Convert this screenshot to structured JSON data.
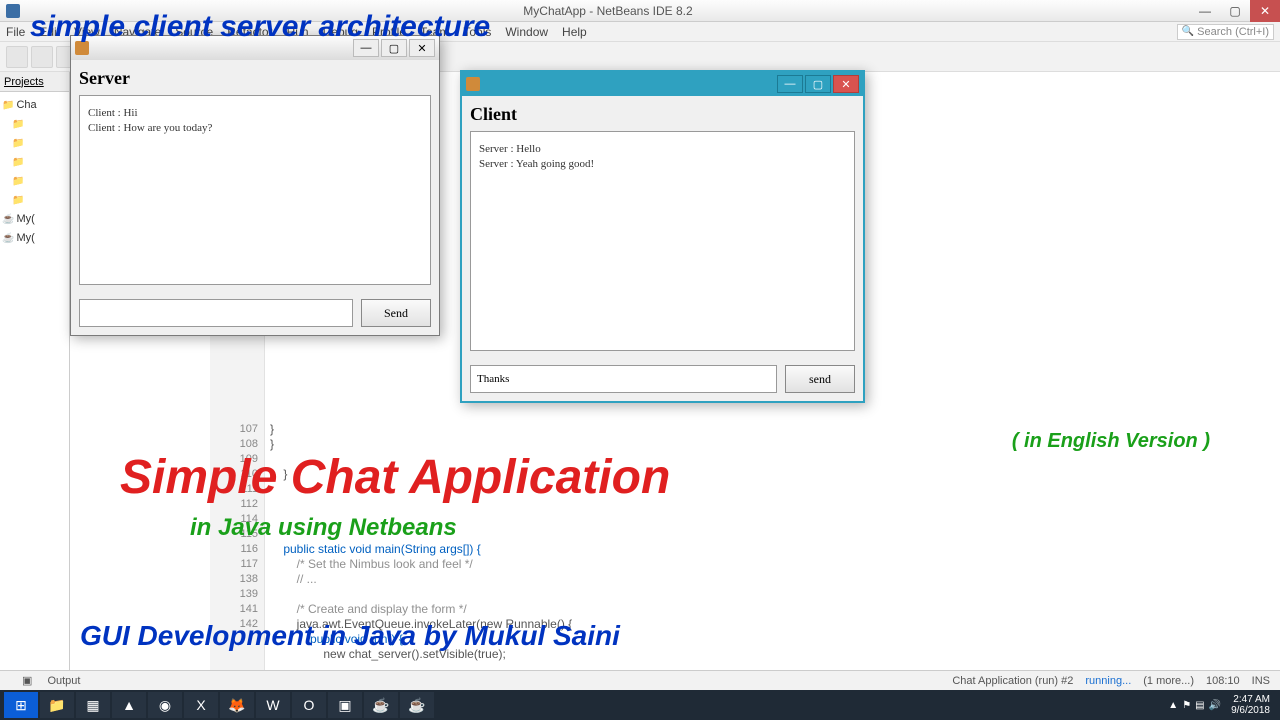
{
  "app": {
    "title": "MyChatApp - NetBeans IDE 8.2",
    "search_placeholder": "Search (Ctrl+I)"
  },
  "menu": [
    "File",
    "Edit",
    "View",
    "Navigate",
    "Source",
    "Refactor",
    "Run",
    "Debug",
    "Profile",
    "Team",
    "Tools",
    "Window",
    "Help"
  ],
  "projects": {
    "tab": "Projects",
    "items": [
      "Cha",
      "",
      "",
      "",
      "",
      "My(",
      "My("
    ]
  },
  "gutter_lines": [
    "107",
    "108",
    "109",
    "110",
    "111",
    "112",
    "",
    "114",
    "115",
    "116",
    "117",
    "138",
    "139",
    "",
    "141",
    "142"
  ],
  "code_lines": [
    {
      "t": "}",
      "cls": ""
    },
    {
      "t": "}",
      "cls": ""
    },
    {
      "t": "",
      "cls": ""
    },
    {
      "t": "    }",
      "cls": ""
    },
    {
      "t": "",
      "cls": ""
    },
    {
      "t": "",
      "cls": ""
    },
    {
      "t": "",
      "cls": ""
    },
    {
      "t": "",
      "cls": ""
    },
    {
      "t": "    public static void main(String args[]) {",
      "cls": "kw"
    },
    {
      "t": "        /* Set the Nimbus look and feel */",
      "cls": "cm"
    },
    {
      "t": "        // ...",
      "cls": "cm"
    },
    {
      "t": "",
      "cls": ""
    },
    {
      "t": "        /* Create and display the form */",
      "cls": "cm"
    },
    {
      "t": "        java.awt.EventQueue.invokeLater(new Runnable() {",
      "cls": ""
    },
    {
      "t": "            public void run() {",
      "cls": "kw"
    },
    {
      "t": "                new chat_server().setVisible(true);",
      "cls": ""
    }
  ],
  "server": {
    "title": "Server",
    "log": "Client : Hii\nClient : How are you today?",
    "input": "",
    "send": "Send"
  },
  "client": {
    "title": "Client",
    "log": "Server : Hello\nServer : Yeah going good!",
    "input": "Thanks",
    "send": "send"
  },
  "overlays": {
    "top": "simple client server architecture",
    "version": "( in English Version )",
    "main": "Simple Chat Application",
    "sub": "in Java using Netbeans",
    "bottom": "GUI Development in Java  by Mukul Saini"
  },
  "status": {
    "output": "Output",
    "run": "Chat Application (run) #2",
    "state": "running...",
    "more": "(1 more...)",
    "pos": "108:10",
    "ins": "INS"
  },
  "tray": {
    "time": "2:47 AM",
    "date": "9/6/2018"
  }
}
